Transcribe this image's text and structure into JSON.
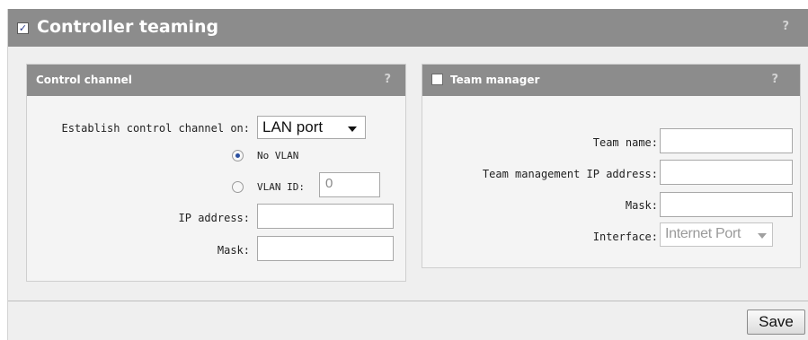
{
  "header": {
    "title": "Controller teaming",
    "enabled": true,
    "help": "?"
  },
  "control_channel": {
    "title": "Control channel",
    "help": "?",
    "establish_label": "Establish control channel on:",
    "establish_value": "LAN port",
    "no_vlan_label": "No VLAN",
    "vlan_id_label": "VLAN ID:",
    "vlan_id_value": "0",
    "selected_option": "No VLAN",
    "ip_label": "IP address:",
    "ip_value": "",
    "mask_label": "Mask:",
    "mask_value": ""
  },
  "team_manager": {
    "title": "Team manager",
    "help": "?",
    "enabled": false,
    "team_name_label": "Team name:",
    "team_name_value": "",
    "mgmt_ip_label": "Team management IP address:",
    "mgmt_ip_value": "",
    "mask_label": "Mask:",
    "mask_value": "",
    "interface_label": "Interface:",
    "interface_value": "Internet Port"
  },
  "actions": {
    "save_label": "Save"
  }
}
